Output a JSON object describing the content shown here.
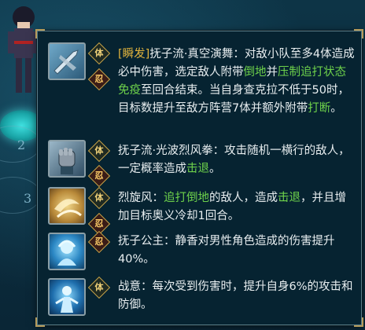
{
  "slots": [
    "2",
    "3"
  ],
  "skills": [
    {
      "badges": [
        "体",
        "忍"
      ],
      "parts": [
        {
          "t": "[瞬发]",
          "c": "gold"
        },
        {
          "t": "抚子流·真空演舞：对敌小队至多4体造成必中伤害，选定敌人附带",
          "c": ""
        },
        {
          "t": "倒地",
          "c": "hl"
        },
        {
          "t": "并",
          "c": ""
        },
        {
          "t": "压制",
          "c": "hl"
        },
        {
          "t": "追打状态免疫",
          "c": "hl"
        },
        {
          "t": "至回合结束。当自身查克拉不低于50时，目标数提升至敌方阵营7体并额外附带",
          "c": ""
        },
        {
          "t": "打断",
          "c": "hl"
        },
        {
          "t": "。",
          "c": ""
        }
      ]
    },
    {
      "badges": [
        "体",
        "忍"
      ],
      "parts": [
        {
          "t": "抚子流·光波烈风拳：攻击随机一横行的敌人，一定概率造成",
          "c": ""
        },
        {
          "t": "击退",
          "c": "hl"
        },
        {
          "t": "。",
          "c": ""
        }
      ]
    },
    {
      "badges": [
        "体",
        "忍"
      ],
      "parts": [
        {
          "t": "烈旋风：",
          "c": ""
        },
        {
          "t": "追打倒地",
          "c": "hl"
        },
        {
          "t": "的敌人，造成",
          "c": ""
        },
        {
          "t": "击退",
          "c": "hl"
        },
        {
          "t": "，并且增加目标奥义冷却1回合。",
          "c": ""
        }
      ]
    },
    {
      "badges": [
        "忍"
      ],
      "parts": [
        {
          "t": "抚子公主：静香对男性角色造成的伤害提升40%。",
          "c": ""
        }
      ]
    },
    {
      "badges": [
        "体"
      ],
      "parts": [
        {
          "t": "战意：每次受到伤害时，提升自身6%的攻击和防御。",
          "c": ""
        }
      ]
    }
  ],
  "colors": {
    "highlight": "#6ed24b",
    "tag": "#e2b43d",
    "text": "#e8eef0",
    "panel": "#062331"
  },
  "icons": [
    "kunai-skill-icon",
    "fist-skill-icon",
    "whirlwind-skill-icon",
    "princess-skill-icon",
    "battle-will-skill-icon"
  ]
}
